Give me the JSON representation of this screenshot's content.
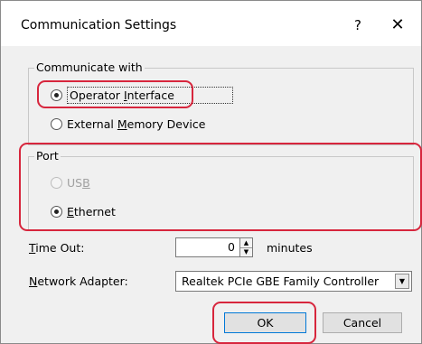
{
  "window": {
    "title": "Communication Settings",
    "help_glyph": "?",
    "close_glyph": "✕"
  },
  "communicate_with": {
    "legend": "Communicate with",
    "options": [
      {
        "pre": "Operator ",
        "mnemonic": "I",
        "post": "nterface",
        "checked": true
      },
      {
        "pre": "External ",
        "mnemonic": "M",
        "post": "emory Device",
        "checked": false
      }
    ]
  },
  "port": {
    "legend": "Port",
    "options": [
      {
        "pre": "US",
        "mnemonic": "B",
        "post": "",
        "checked": false,
        "disabled": true
      },
      {
        "pre": "",
        "mnemonic": "E",
        "post": "thernet",
        "checked": true,
        "disabled": false
      }
    ]
  },
  "timeout": {
    "label_mnemonic": "T",
    "label_rest": "ime Out:",
    "value": "0",
    "unit": "minutes"
  },
  "network_adapter": {
    "label_mnemonic": "N",
    "label_rest": "etwork Adapter:",
    "selected": "Realtek PCIe GBE Family Controller"
  },
  "buttons": {
    "ok": "OK",
    "cancel": "Cancel"
  },
  "colors": {
    "highlight": "#d7263d",
    "default_button_border": "#0078d7"
  }
}
